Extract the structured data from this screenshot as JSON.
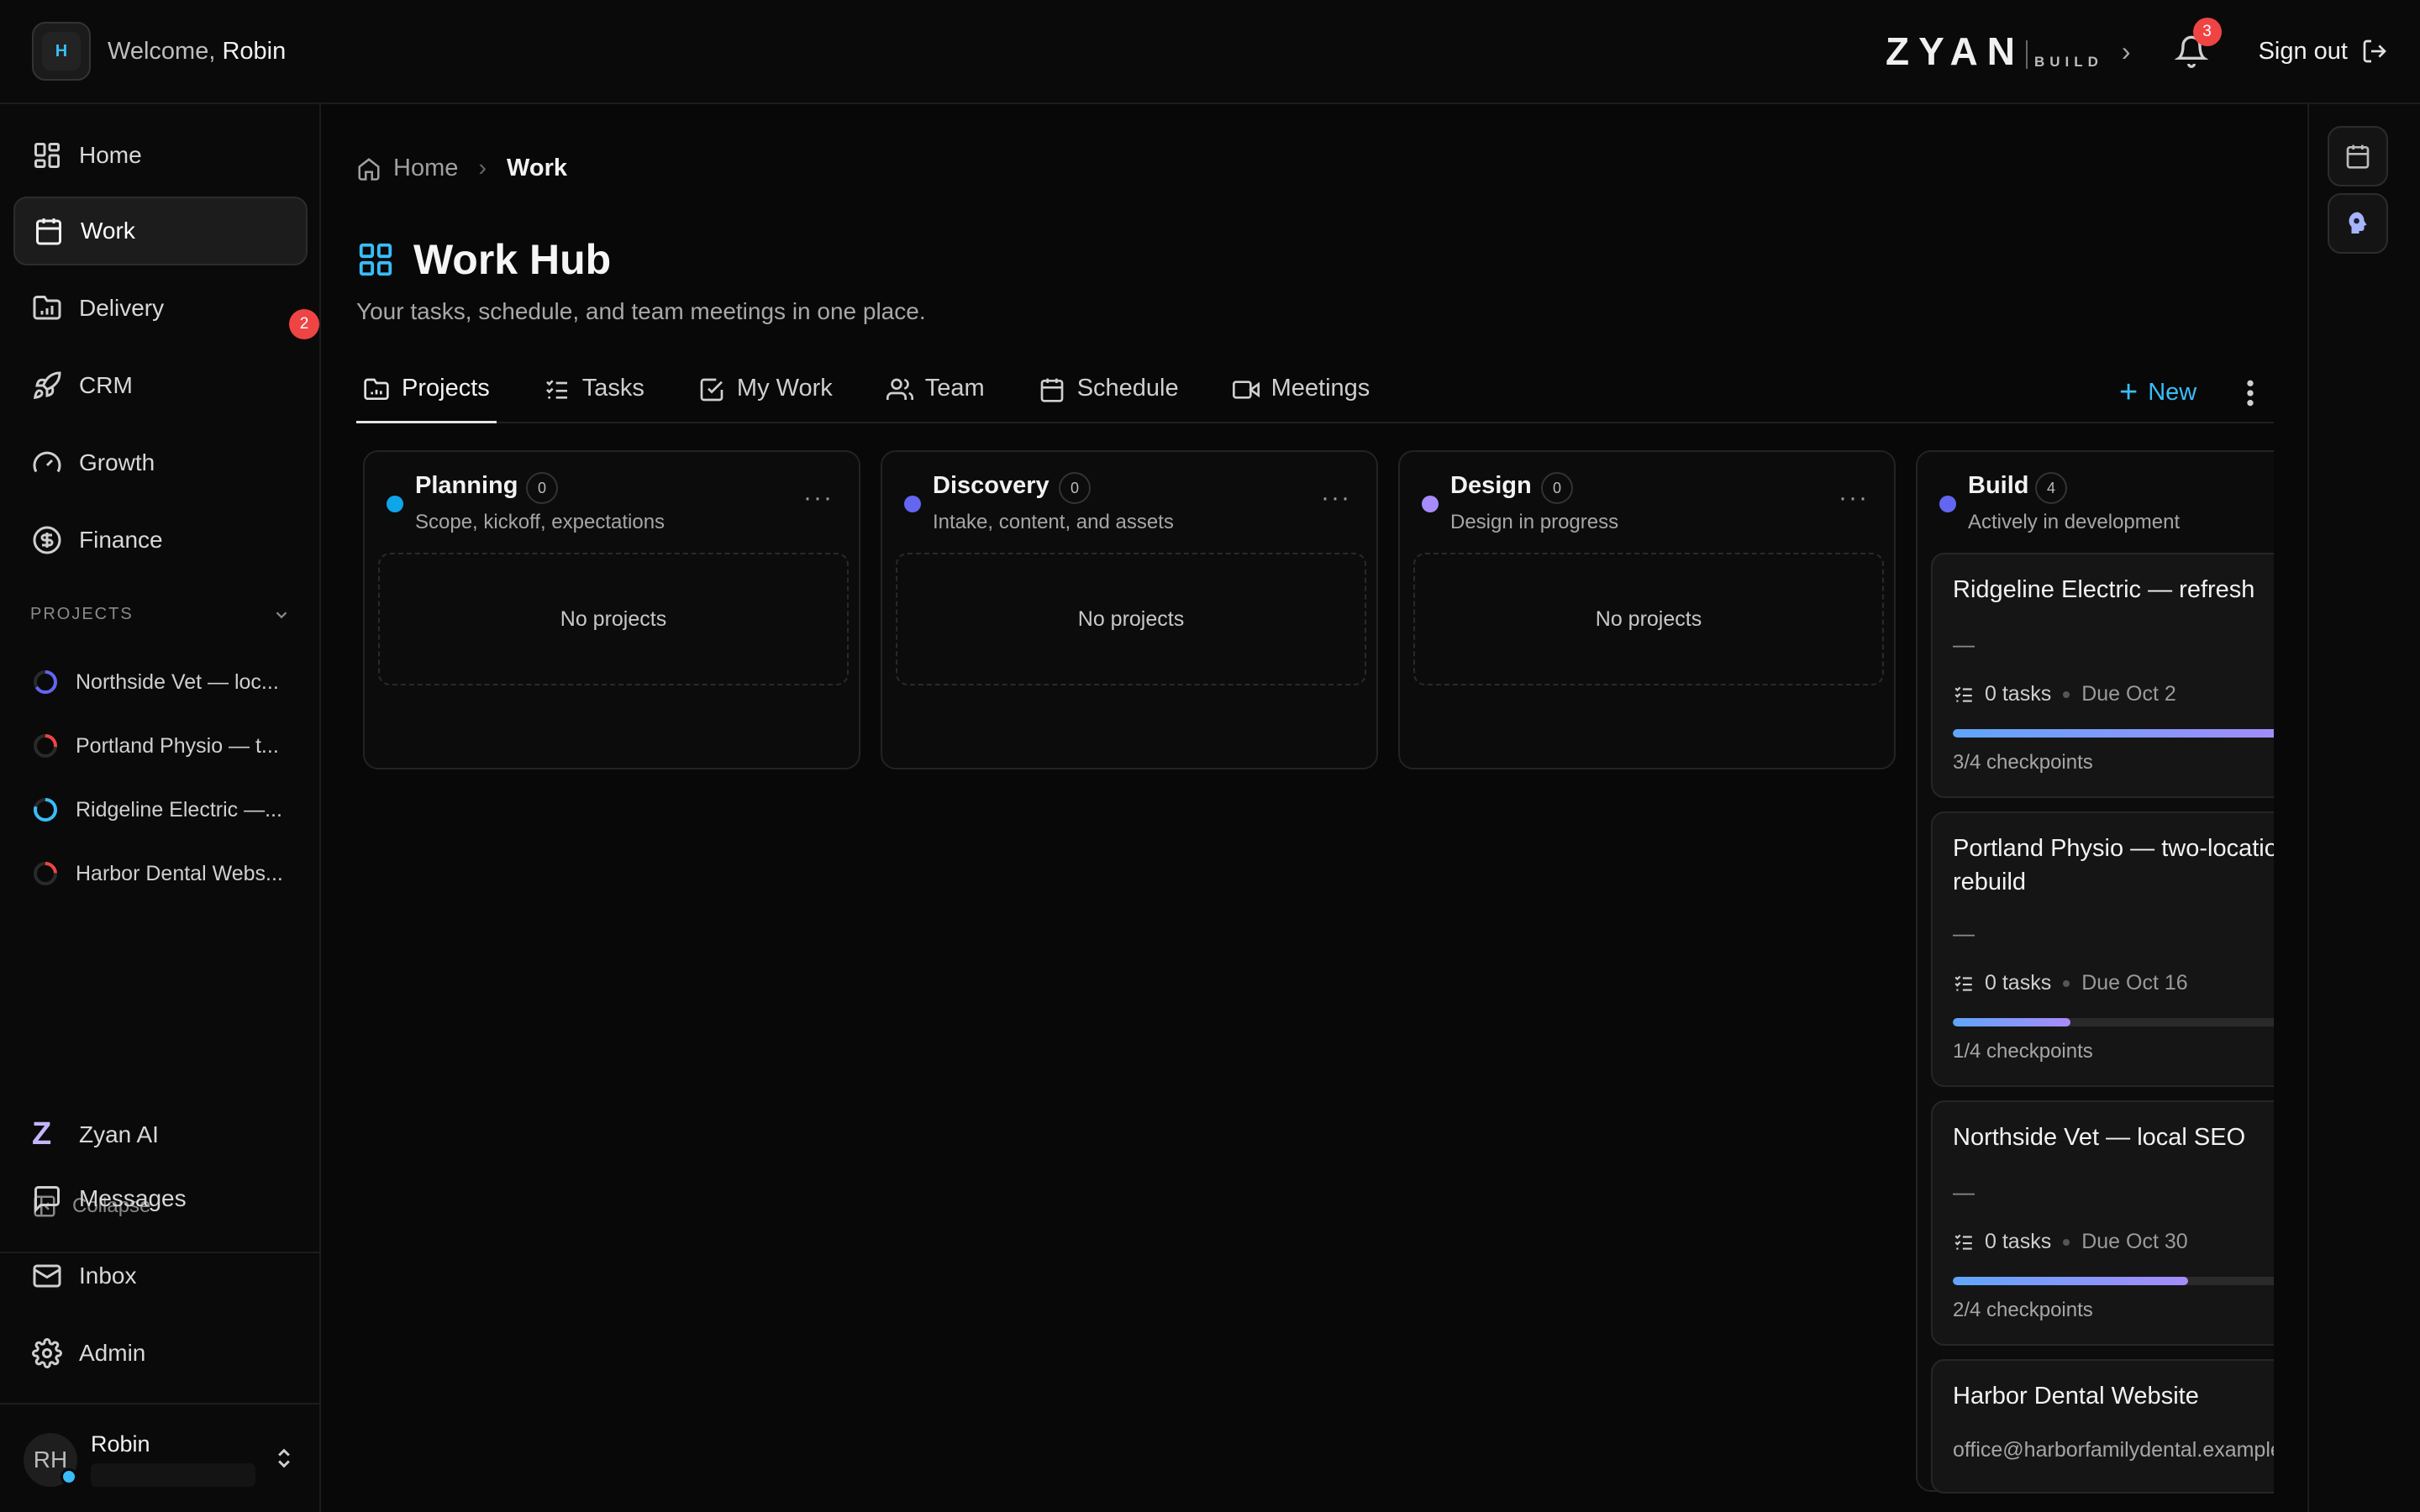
{
  "topbar": {
    "org_initial": "H",
    "welcome_prefix": "Welcome,",
    "welcome_name": "Robin",
    "logo_word": "ZYAN",
    "logo_sub": "BUILD",
    "notifications_count": "3",
    "signout_label": "Sign out"
  },
  "sidebar": {
    "items": [
      {
        "label": "Home",
        "icon": "grid-icon"
      },
      {
        "label": "Work",
        "icon": "calendar-icon",
        "active": true
      },
      {
        "label": "Delivery",
        "icon": "folder-chart-icon",
        "badge": "2"
      },
      {
        "label": "CRM",
        "icon": "rocket-icon"
      },
      {
        "label": "Growth",
        "icon": "gauge-icon"
      },
      {
        "label": "Finance",
        "icon": "dollar-circle-icon"
      }
    ],
    "projects_header": "PROJECTS",
    "projects": [
      {
        "label": "Northside Vet — loc...",
        "color": "#6366f1"
      },
      {
        "label": "Portland Physio — t...",
        "color": "#ef4444"
      },
      {
        "label": "Ridgeline Electric —...",
        "color": "#38bdf8"
      },
      {
        "label": "Harbor Dental Webs...",
        "color": "#ef4444"
      }
    ],
    "ai_label": "Zyan AI",
    "collapse_label": "Collapse",
    "bottom_items": [
      {
        "label": "Messages",
        "icon": "message-icon"
      },
      {
        "label": "Inbox",
        "icon": "mail-icon"
      },
      {
        "label": "Admin",
        "icon": "gear-icon"
      }
    ],
    "user": {
      "initials": "RH",
      "name": "Robin"
    }
  },
  "main": {
    "breadcrumb": {
      "home": "Home",
      "current": "Work"
    },
    "title": "Work Hub",
    "subtitle": "Your tasks, schedule, and team meetings in one place.",
    "tabs": [
      {
        "label": "Projects",
        "icon": "folder-icon",
        "active": true
      },
      {
        "label": "Tasks",
        "icon": "list-check-icon"
      },
      {
        "label": "My Work",
        "icon": "checkbox-icon"
      },
      {
        "label": "Team",
        "icon": "users-icon"
      },
      {
        "label": "Schedule",
        "icon": "calendar-icon"
      },
      {
        "label": "Meetings",
        "icon": "video-icon"
      }
    ],
    "new_label": "New"
  },
  "board": {
    "columns": [
      {
        "title": "Planning",
        "count": "0",
        "desc": "Scope, kickoff, expectations",
        "color": "#0ea5e9",
        "empty": "No projects"
      },
      {
        "title": "Discovery",
        "count": "0",
        "desc": "Intake, content, and assets",
        "color": "#6366f1",
        "empty": "No projects"
      },
      {
        "title": "Design",
        "count": "0",
        "desc": "Design in progress",
        "color": "#a78bfa",
        "empty": "No projects"
      },
      {
        "title": "Build",
        "count": "4",
        "desc": "Actively in development",
        "color": "#6366f1"
      }
    ],
    "cards": [
      {
        "title": "Ridgeline Electric — refresh",
        "dash": "—",
        "tasks": "0 tasks",
        "due": "Due Oct 2",
        "progress": 0.75,
        "checkpoints": "3/4 checkpoints"
      },
      {
        "title": "Portland Physio — two-location rebuild",
        "dash": "—",
        "tasks": "0 tasks",
        "due": "Due Oct 16",
        "progress": 0.25,
        "checkpoints": "1/4 checkpoints"
      },
      {
        "title": "Northside Vet — local SEO",
        "dash": "—",
        "tasks": "0 tasks",
        "due": "Due Oct 30",
        "progress": 0.5,
        "checkpoints": "2/4 checkpoints"
      },
      {
        "title": "Harbor Dental Website",
        "email": "office@harborfamilydental.example"
      }
    ]
  }
}
